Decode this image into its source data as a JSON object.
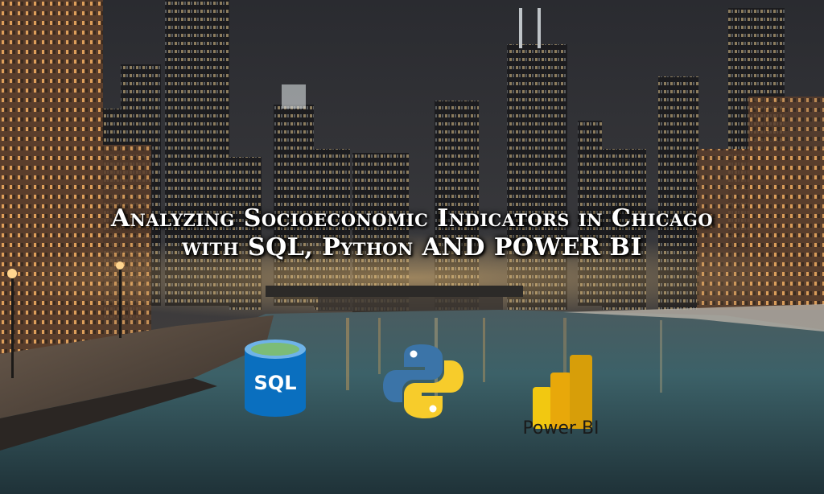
{
  "title": {
    "line1": "Analyzing Socioeconomic Indicators in Chicago",
    "line2": "with SQL, Python AND POWER BI"
  },
  "logos": {
    "sql": {
      "icon": "sql-database-icon",
      "text": "SQL",
      "color": "#0a6fbf"
    },
    "python": {
      "icon": "python-icon",
      "colors": [
        "#3b74a8",
        "#f7cc2b"
      ]
    },
    "powerbi": {
      "icon": "power-bi-icon",
      "caption": "Power BI",
      "colors": [
        "#f2c811",
        "#e8a80a",
        "#c98706"
      ]
    }
  },
  "colors": {
    "sky": "#2d2e33",
    "water": "#3b5d66",
    "lights": "#ffb55a"
  }
}
